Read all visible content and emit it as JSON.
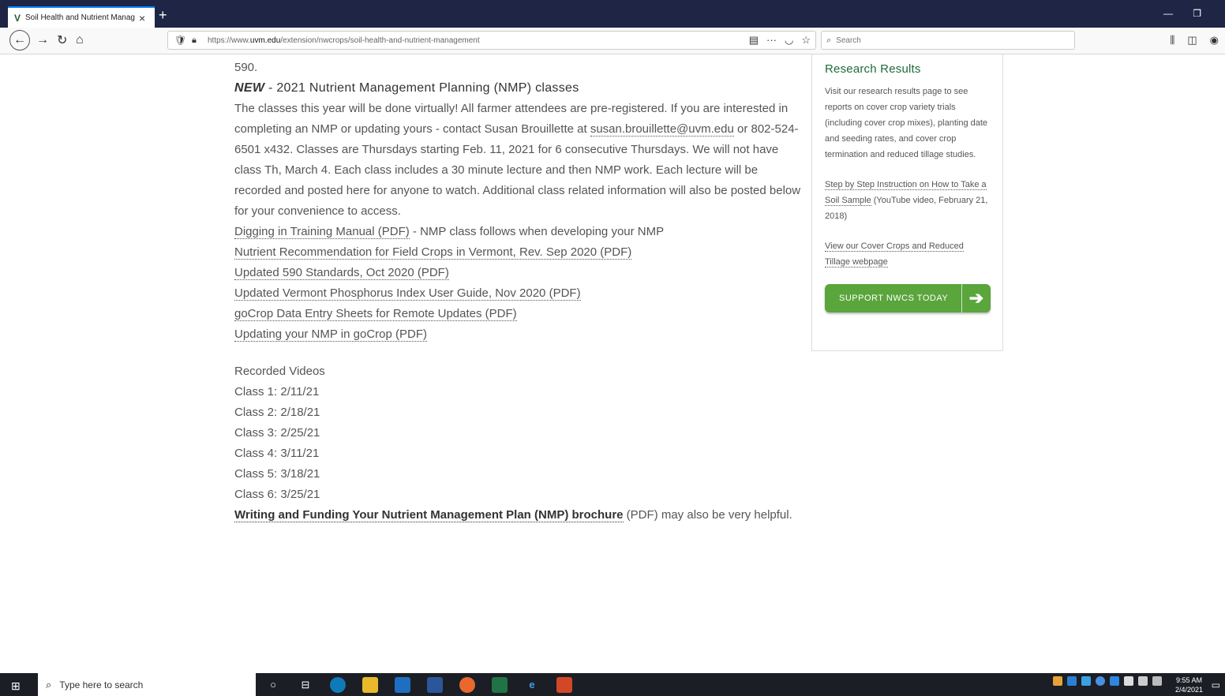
{
  "browser": {
    "tab_title": "Soil Health and Nutrient Manag",
    "tab_favicon": "V",
    "new_tab": "+",
    "url_prefix": "https://www.",
    "url_domain": "uvm.edu",
    "url_path": "/extension/nwcrops/soil-health-and-nutrient-management",
    "search_placeholder": "Search"
  },
  "main": {
    "intro_tail": "590.",
    "heading_new": "NEW",
    "heading_rest": " - 2021 Nutrient Management Planning (NMP) classes",
    "para_1": "The classes this year will be done virtually! All farmer attendees are pre-registered. If you are interested in completing an NMP or updating yours - contact Susan Brouillette at ",
    "email": "susan.brouillette@uvm.edu",
    "para_2": " or 802-524-6501 x432. Classes are Thursdays starting Feb. 11, 2021 for 6 consecutive Thursdays. We will not have class Th, March 4. Each class includes a 30 minute lecture and then NMP work. Each lecture will be recorded and posted here for anyone to watch. Additional class related information will also be posted below for your convenience to access.",
    "link_1": "Digging in Training Manual (PDF)",
    "link_1_suffix": " - NMP class follows when developing your NMP",
    "link_2": "Nutrient Recommendation for Field Crops in Vermont, Rev. Sep 2020 (PDF)",
    "link_3": "Updated 590 Standards, Oct 2020 (PDF)",
    "link_4": "Updated Vermont Phosphorus Index User Guide, Nov 2020 (PDF)",
    "link_5": "goCrop Data Entry Sheets for Remote Updates (PDF)",
    "link_6": "Updating your NMP in goCrop (PDF)",
    "videos_heading": "Recorded Videos",
    "videos": [
      "Class 1: 2/11/21",
      "Class 2: 2/18/21",
      "Class 3: 2/25/21",
      "Class 4: 3/11/21",
      "Class 5: 3/18/21",
      "Class 6: 3/25/21"
    ],
    "brochure_link": "Writing and Funding Your Nutrient Management Plan (NMP) brochure",
    "brochure_suffix": " (PDF) may also be very helpful."
  },
  "sidebar": {
    "title": "Research Results",
    "desc": "Visit our research results page to see reports on cover crop variety trials (including cover crop mixes), planting date and seeding rates, and cover crop termination and reduced tillage studies.",
    "step_link": "Step by Step Instruction on How to Take a Soil Sample",
    "step_suffix": " (YouTube video, February 21, 2018)",
    "cover_link": "View our Cover Crops and Reduced Tillage webpage",
    "support_label": "SUPPORT NWCS TODAY"
  },
  "taskbar": {
    "search_text": "Type here to search",
    "time": "9:55 AM",
    "date": "2/4/2021"
  },
  "colors": {
    "tabbar": "#1e2545",
    "accent_green": "#1f6b3a",
    "button_green": "#5aa53c"
  }
}
